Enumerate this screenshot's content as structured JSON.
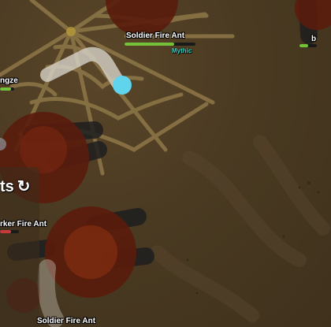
{
  "entities": {
    "soldier_top": {
      "name": "Soldier Fire Ant",
      "rarity": "Mythic",
      "hp": 0.7
    },
    "soldier_bottom": {
      "name": "Soldier Fire Ant"
    },
    "worker_left": {
      "name": "rker Fire Ant",
      "hp": 0.6
    },
    "bronze_left": {
      "name": "ngze",
      "hp": 0.8
    },
    "right_partial": {
      "name": "b",
      "hp": 0.5
    }
  },
  "panel": {
    "title": "ts",
    "refresh_icon": "↻"
  },
  "colors": {
    "ground": "#4a3a22",
    "web": "#8a7446",
    "fire_ant": "#5a1c0c",
    "fire_ant_inner": "#7a2a10",
    "shadow_leg": "#1e1e1e",
    "player": "#5fd4ec",
    "health": "#73c23a"
  }
}
